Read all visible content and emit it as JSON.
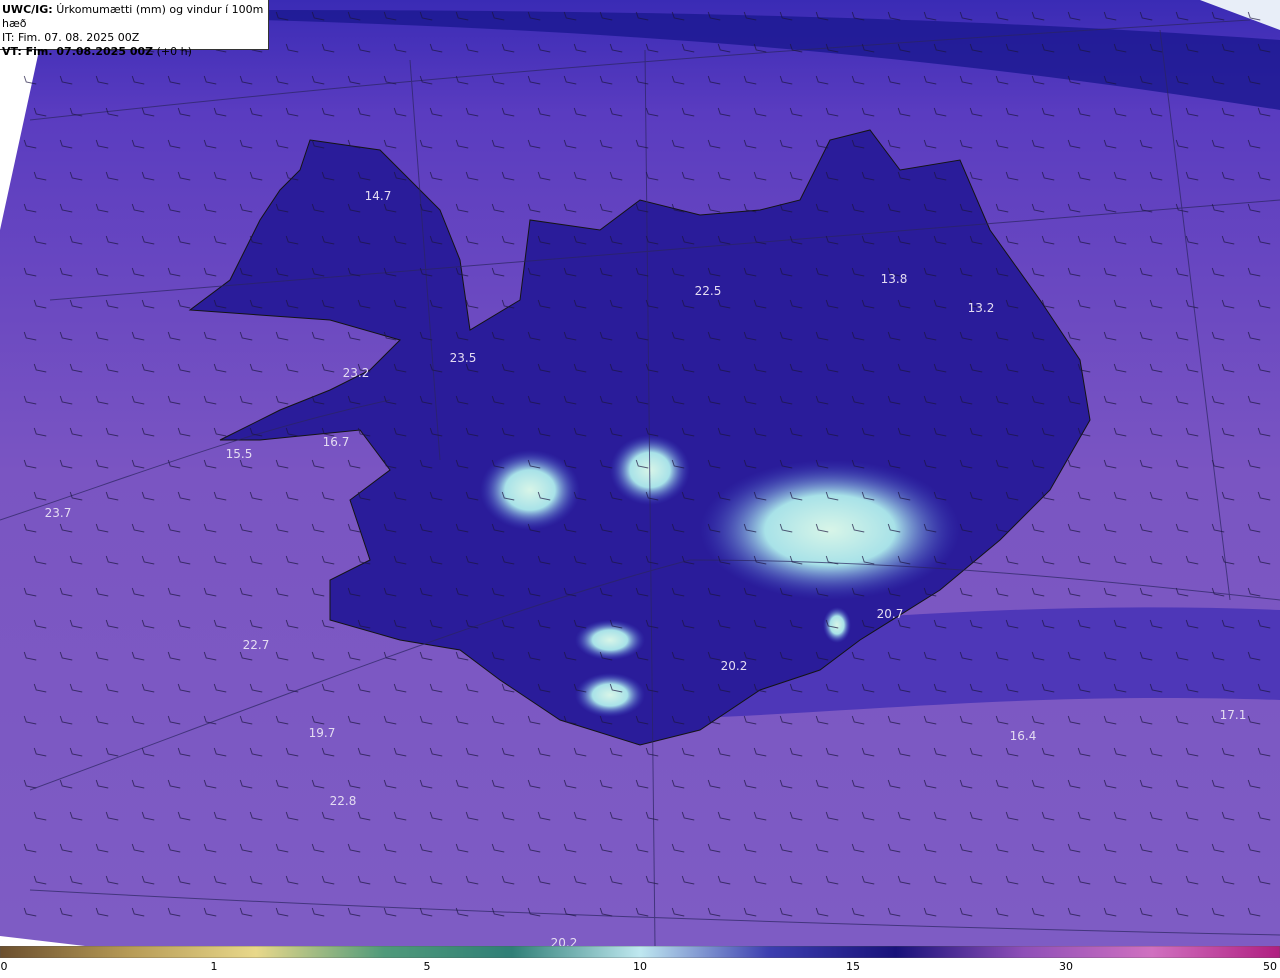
{
  "header": {
    "model_prefix": "UWC/IG:",
    "field_title": "Úrkomumætti (mm) og vindur í 100m hæð",
    "init_time": "IT: Fim. 07. 08. 2025 00Z",
    "valid_prefix": "VT: Fim. 07.08.2025 00Z",
    "valid_offset": "(+0 h)"
  },
  "map_values": [
    {
      "id": "v1",
      "text": "14.7"
    },
    {
      "id": "v2",
      "text": "22.5"
    },
    {
      "id": "v3",
      "text": "13.8"
    },
    {
      "id": "v4",
      "text": "13.2"
    },
    {
      "id": "v5",
      "text": "23.5"
    },
    {
      "id": "v6",
      "text": "23.2"
    },
    {
      "id": "v7",
      "text": "16.7"
    },
    {
      "id": "v8",
      "text": "15.5"
    },
    {
      "id": "v9",
      "text": "23.7"
    },
    {
      "id": "v10",
      "text": "20.7"
    },
    {
      "id": "v11",
      "text": "22.7"
    },
    {
      "id": "v12",
      "text": "20.2"
    },
    {
      "id": "v13",
      "text": "19.7"
    },
    {
      "id": "v14",
      "text": "16.4"
    },
    {
      "id": "v15",
      "text": "17.1"
    },
    {
      "id": "v16",
      "text": "22.8"
    },
    {
      "id": "v17",
      "text": "20.2"
    }
  ],
  "colorbar": {
    "ticks": [
      "0",
      "1",
      "5",
      "10",
      "15",
      "30",
      "50"
    ],
    "colors": [
      "#6b4f2e",
      "#b69a55",
      "#e8d88a",
      "#4f9a7a",
      "#2f7f77",
      "#bfe8f0",
      "#3d3fb0",
      "#18127a",
      "#8f4fb8",
      "#d070c0",
      "#b01e80"
    ]
  },
  "colors": {
    "field_low": "#7a55c0",
    "field_mid": "#2a1a9a",
    "field_high": "#b8f0e0",
    "coast": "#1a1a1a"
  }
}
